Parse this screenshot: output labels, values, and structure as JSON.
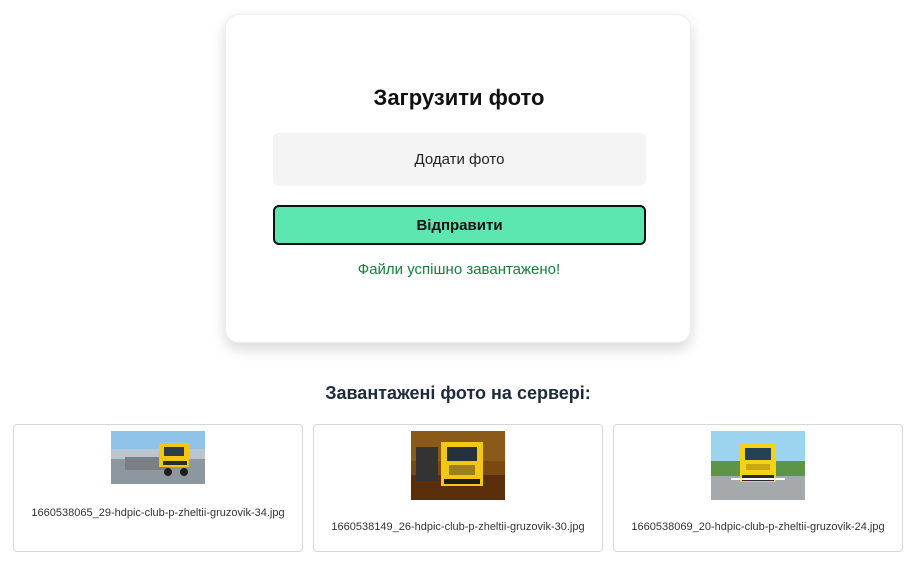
{
  "upload": {
    "title": "Загрузити фото",
    "add_photo_label": "Додати фото",
    "submit_label": "Відправити",
    "success_message": "Файли успішно завантажено!"
  },
  "gallery": {
    "heading": "Завантажені фото на сервері:",
    "photos": [
      {
        "filename": "1660538065_29-hdpic-club-p-zheltii-gruzovik-34.jpg"
      },
      {
        "filename": "1660538149_26-hdpic-club-p-zheltii-gruzovik-30.jpg"
      },
      {
        "filename": "1660538069_20-hdpic-club-p-zheltii-gruzovik-24.jpg"
      }
    ]
  },
  "colors": {
    "submit_button": "#5ce6b0",
    "success_text": "#15803d",
    "card_border": "#d7d7d7"
  }
}
